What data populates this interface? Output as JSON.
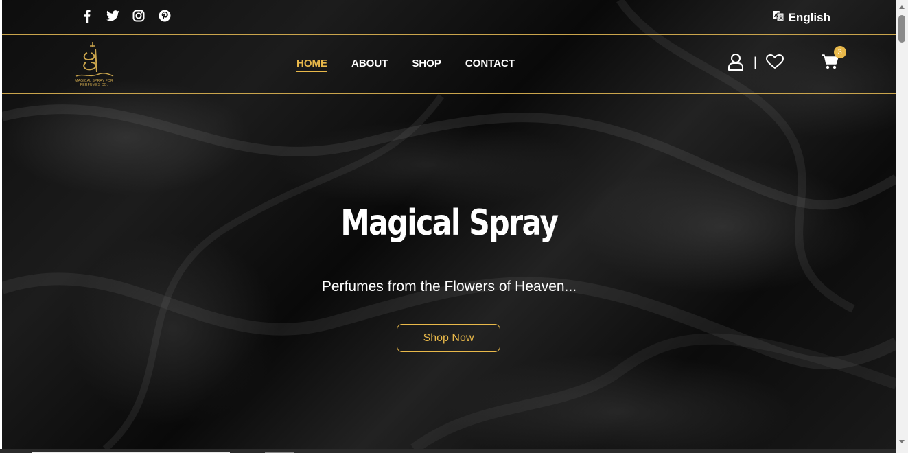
{
  "topbar": {
    "socials": [
      {
        "icon": "facebook-icon"
      },
      {
        "icon": "twitter-icon"
      },
      {
        "icon": "instagram-icon"
      },
      {
        "icon": "pinterest-icon"
      }
    ],
    "language": {
      "icon": "translate-icon",
      "label": "English"
    }
  },
  "navbar": {
    "logo": {
      "tagline": "MAGICAL SPRAY FOR PERFUMES CO."
    },
    "links": [
      {
        "label": "HOME",
        "active": true
      },
      {
        "label": "ABOUT",
        "active": false
      },
      {
        "label": "SHOP",
        "active": false
      },
      {
        "label": "CONTACT",
        "active": false
      }
    ],
    "separator": "|",
    "cart_count": "3"
  },
  "hero": {
    "title": "Magical Spray",
    "subtitle": "Perfumes from the Flowers of Heaven...",
    "cta_label": "Shop Now"
  },
  "colors": {
    "accent": "#e8b84a",
    "divider": "#c9a44c",
    "background": "#111111",
    "text": "#ffffff"
  }
}
